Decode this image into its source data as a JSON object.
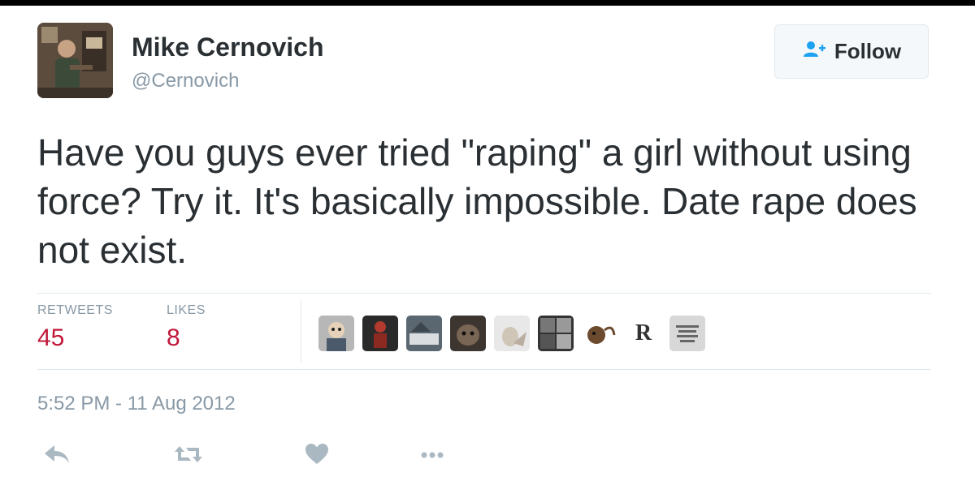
{
  "tweet": {
    "author": {
      "display_name": "Mike Cernovich",
      "handle": "@Cernovich",
      "avatar": "profile-photo"
    },
    "follow_button": {
      "label": "Follow",
      "icon": "add-user-icon"
    },
    "text": "Have you guys ever tried \"raping\" a girl without using force? Try it. It's basically impossible. Date rape does not exist.",
    "stats": {
      "retweets_label": "RETWEETS",
      "retweets_count": "45",
      "likes_label": "LIKES",
      "likes_count": "8"
    },
    "liked_by_avatars": [
      {
        "icon": "cartoon-avatar"
      },
      {
        "icon": "red-figure-avatar"
      },
      {
        "icon": "photo-avatar"
      },
      {
        "icon": "dog-avatar"
      },
      {
        "icon": "rocket-avatar"
      },
      {
        "icon": "collage-avatar"
      },
      {
        "icon": "monkey-avatar"
      },
      {
        "icon": "letter-r-avatar",
        "text": "R"
      },
      {
        "icon": "text-logo-avatar"
      }
    ],
    "timestamp": "5:52 PM - 11 Aug 2012",
    "actions": [
      {
        "name": "reply",
        "icon": "reply-icon"
      },
      {
        "name": "retweet",
        "icon": "retweet-icon"
      },
      {
        "name": "like",
        "icon": "heart-icon"
      },
      {
        "name": "more",
        "icon": "more-icon"
      }
    ]
  },
  "colors": {
    "text": "#292f33",
    "muted": "#8899a6",
    "count": "#c0183a",
    "icon": "#aab8c2",
    "follow_icon": "#1da1f2",
    "divider": "#e1e8ed"
  }
}
